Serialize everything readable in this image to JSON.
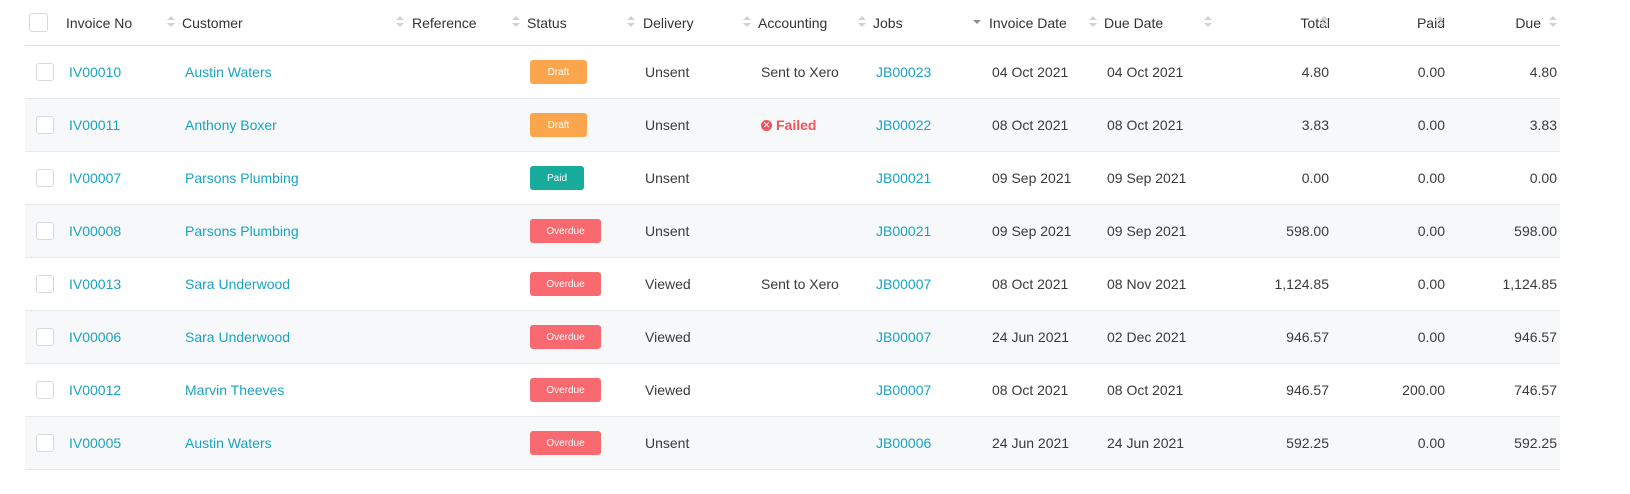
{
  "columns": {
    "invoice_no": "Invoice No",
    "customer": "Customer",
    "reference": "Reference",
    "status": "Status",
    "delivery": "Delivery",
    "accounting": "Accounting",
    "jobs": "Jobs",
    "invoice_date": "Invoice Date",
    "due_date": "Due Date",
    "total": "Total",
    "paid": "Paid",
    "due": "Due"
  },
  "status_colors": {
    "Draft": "#fba64c",
    "Paid": "#17ab9c",
    "Overdue": "#f86a6f"
  },
  "accent_color": "#1aa3c0",
  "rows": [
    {
      "invoice_no": "IV00010",
      "customer": "Austin Waters",
      "reference": "",
      "status": "Draft",
      "delivery": "Unsent",
      "accounting": "Sent to Xero",
      "accounting_failed": false,
      "jobs": "JB00023",
      "invoice_date": "04 Oct 2021",
      "due_date": "04 Oct 2021",
      "total": "4.80",
      "paid": "0.00",
      "due": "4.80"
    },
    {
      "invoice_no": "IV00011",
      "customer": "Anthony Boxer",
      "reference": "",
      "status": "Draft",
      "delivery": "Unsent",
      "accounting": "Failed",
      "accounting_failed": true,
      "jobs": "JB00022",
      "invoice_date": "08 Oct 2021",
      "due_date": "08 Oct 2021",
      "total": "3.83",
      "paid": "0.00",
      "due": "3.83"
    },
    {
      "invoice_no": "IV00007",
      "customer": "Parsons Plumbing",
      "reference": "",
      "status": "Paid",
      "delivery": "Unsent",
      "accounting": "",
      "accounting_failed": false,
      "jobs": "JB00021",
      "invoice_date": "09 Sep 2021",
      "due_date": "09 Sep 2021",
      "total": "0.00",
      "paid": "0.00",
      "due": "0.00"
    },
    {
      "invoice_no": "IV00008",
      "customer": "Parsons Plumbing",
      "reference": "",
      "status": "Overdue",
      "delivery": "Unsent",
      "accounting": "",
      "accounting_failed": false,
      "jobs": "JB00021",
      "invoice_date": "09 Sep 2021",
      "due_date": "09 Sep 2021",
      "total": "598.00",
      "paid": "0.00",
      "due": "598.00"
    },
    {
      "invoice_no": "IV00013",
      "customer": "Sara Underwood",
      "reference": "",
      "status": "Overdue",
      "delivery": "Viewed",
      "accounting": "Sent to Xero",
      "accounting_failed": false,
      "jobs": "JB00007",
      "invoice_date": "08 Oct 2021",
      "due_date": "08 Nov 2021",
      "total": "1,124.85",
      "paid": "0.00",
      "due": "1,124.85"
    },
    {
      "invoice_no": "IV00006",
      "customer": "Sara Underwood",
      "reference": "",
      "status": "Overdue",
      "delivery": "Viewed",
      "accounting": "",
      "accounting_failed": false,
      "jobs": "JB00007",
      "invoice_date": "24 Jun 2021",
      "due_date": "02 Dec 2021",
      "total": "946.57",
      "paid": "0.00",
      "due": "946.57"
    },
    {
      "invoice_no": "IV00012",
      "customer": "Marvin Theeves",
      "reference": "",
      "status": "Overdue",
      "delivery": "Viewed",
      "accounting": "",
      "accounting_failed": false,
      "jobs": "JB00007",
      "invoice_date": "08 Oct 2021",
      "due_date": "08 Oct 2021",
      "total": "946.57",
      "paid": "200.00",
      "due": "746.57"
    },
    {
      "invoice_no": "IV00005",
      "customer": "Austin Waters",
      "reference": "",
      "status": "Overdue",
      "delivery": "Unsent",
      "accounting": "",
      "accounting_failed": false,
      "jobs": "JB00006",
      "invoice_date": "24 Jun 2021",
      "due_date": "24 Jun 2021",
      "total": "592.25",
      "paid": "0.00",
      "due": "592.25"
    }
  ]
}
